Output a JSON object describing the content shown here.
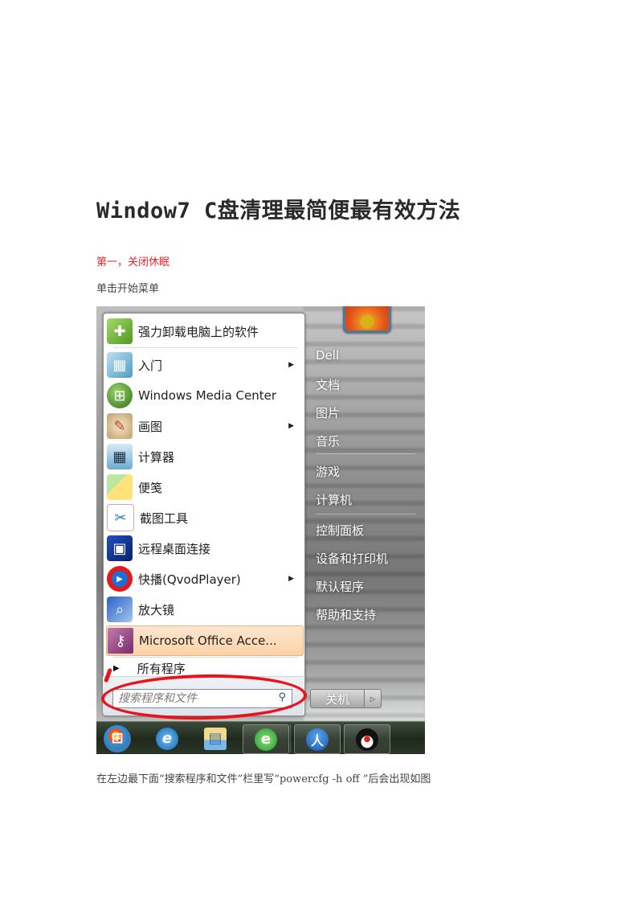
{
  "document": {
    "title": "Window7 C盘清理最简便最有效方法",
    "section_heading": "第一，关闭休眠",
    "paragraph_1": "单击开始菜单",
    "paragraph_2": "在左边最下面“搜索程序和文件”栏里写“powercfg -h off ”后会出现如图",
    "colors": {
      "heading_red": "#e8242c",
      "annotation_red": "#e8141a"
    }
  },
  "start_menu": {
    "left_items": [
      {
        "label": "强力卸载电脑上的软件",
        "icon": "uninstall-icon",
        "has_submenu": false
      },
      {
        "label": "入门",
        "icon": "getting-started-icon",
        "has_submenu": true
      },
      {
        "label": "Windows Media Center",
        "icon": "media-center-icon",
        "has_submenu": false
      },
      {
        "label": "画图",
        "icon": "paint-icon",
        "has_submenu": true
      },
      {
        "label": "计算器",
        "icon": "calculator-icon",
        "has_submenu": false
      },
      {
        "label": "便笺",
        "icon": "sticky-notes-icon",
        "has_submenu": false
      },
      {
        "label": "截图工具",
        "icon": "snipping-tool-icon",
        "has_submenu": false
      },
      {
        "label": "远程桌面连接",
        "icon": "remote-desktop-icon",
        "has_submenu": false
      },
      {
        "label": "快播(QvodPlayer)",
        "icon": "qvod-player-icon",
        "has_submenu": true
      },
      {
        "label": "放大镜",
        "icon": "magnifier-icon",
        "has_submenu": false
      },
      {
        "label": "Microsoft Office Acce...",
        "icon": "ms-access-icon",
        "has_submenu": false,
        "highlighted": true
      }
    ],
    "all_programs_label": "所有程序",
    "search_placeholder": "搜索程序和文件",
    "right_links": [
      "Dell",
      "文档",
      "图片",
      "音乐",
      "游戏",
      "计算机",
      "控制面板",
      "设备和打印机",
      "默认程序",
      "帮助和支持"
    ],
    "shutdown_label": "关机",
    "highlight_color": "#fbd2a8"
  },
  "taskbar": {
    "items": [
      {
        "name": "start-orb-icon",
        "glyph": "⊞"
      },
      {
        "name": "internet-explorer-icon",
        "glyph": "e"
      },
      {
        "name": "file-explorer-icon",
        "glyph": "▤"
      },
      {
        "name": "browser-green-e-icon",
        "glyph": "e"
      },
      {
        "name": "app-blue-icon",
        "glyph": "人"
      },
      {
        "name": "qq-penguin-icon",
        "glyph": "●"
      }
    ]
  }
}
